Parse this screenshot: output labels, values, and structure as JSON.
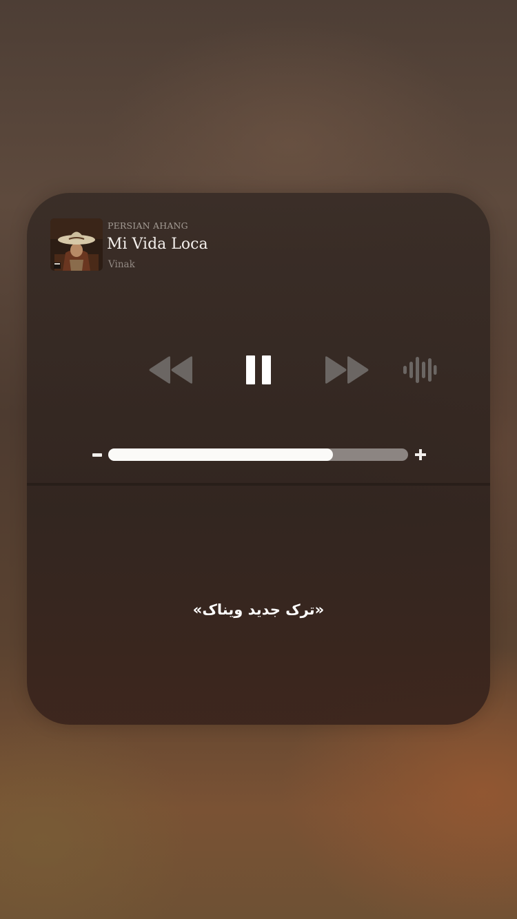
{
  "now_playing": {
    "source": "PERSIAN AHANG",
    "title": "Mi Vida Loca",
    "artist": "Vinak"
  },
  "controls": {
    "rewind_icon": "rewind-icon",
    "pause_icon": "pause-icon",
    "fast_forward_icon": "fast-forward-icon",
    "audio_output_icon": "audio-waveform-icon"
  },
  "volume": {
    "level_percent": 75,
    "minus_icon": "minus-icon",
    "plus_icon": "plus-icon"
  },
  "caption": "«ترک جدید ویناک»",
  "colors": {
    "panel": "#35291f",
    "control_icon": "#6b6663",
    "pause_icon": "#ffffff",
    "volume_fill": "#fbfaf8",
    "volume_track": "#8c8582"
  }
}
